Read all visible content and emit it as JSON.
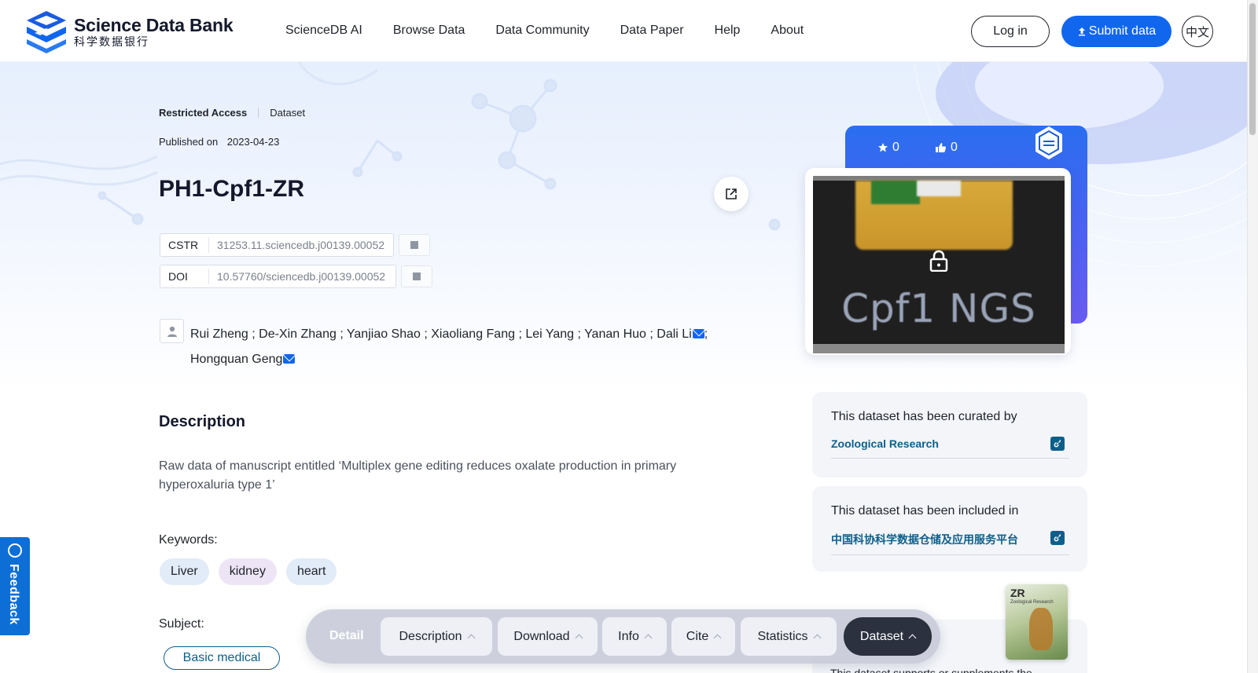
{
  "header": {
    "logo_title": "Science Data Bank",
    "logo_sub": "科学数据银行",
    "nav": [
      "ScienceDB AI",
      "Browse Data",
      "Data Community",
      "Data Paper",
      "Help",
      "About"
    ],
    "login": "Log in",
    "submit": "Submit data",
    "lang": "中文"
  },
  "dataset": {
    "access": "Restricted Access",
    "type": "Dataset",
    "published_label": "Published on",
    "published_date": "2023-04-23",
    "title": "PH1-Cpf1-ZR",
    "cstr_label": "CSTR",
    "cstr_value": "31253.11.sciencedb.j00139.00052",
    "doi_label": "DOI",
    "doi_value": "10.57760/sciencedb.j00139.00052",
    "authors_line1": "Rui Zheng ; De-Xin Zhang ; Yanjiao Shao ; Xiaoliang Fang ; Lei Yang ; Yanan Huo ; Dali Li",
    "authors_line1_suffix": ";",
    "authors_line2": "Hongquan Geng",
    "description_heading": "Description",
    "description": "Raw data of manuscript entitled ‘Multiplex gene editing reduces oxalate production in primary hyperoxaluria type 1’",
    "keywords_label": "Keywords:",
    "keywords": [
      "Liver",
      "kidney",
      "heart"
    ],
    "subject_label": "Subject:",
    "subject": "Basic medical"
  },
  "card": {
    "stars": "0",
    "likes": "0",
    "preview_text": "Cpf1 NGS",
    "curated_label": "This dataset has been curated by",
    "curated_link": "Zoological Research",
    "included_label": "This dataset has been included in",
    "included_link": "中国科协科学数据仓储及应用服务平台",
    "supports_text": "This dataset supports or supplements the",
    "cover_title": "ZR",
    "cover_sub": "Zoological Research"
  },
  "feedback": "Feedback",
  "bottom_nav": {
    "detail": "Detail",
    "items": [
      "Description",
      "Download",
      "Info",
      "Cite",
      "Statistics",
      "Dataset"
    ],
    "active": "Dataset"
  },
  "colors": {
    "accent": "#1166ee",
    "link": "#0d5f8a",
    "card_gradient_start": "#2a6ef0",
    "card_gradient_end": "#6a5cf0"
  }
}
